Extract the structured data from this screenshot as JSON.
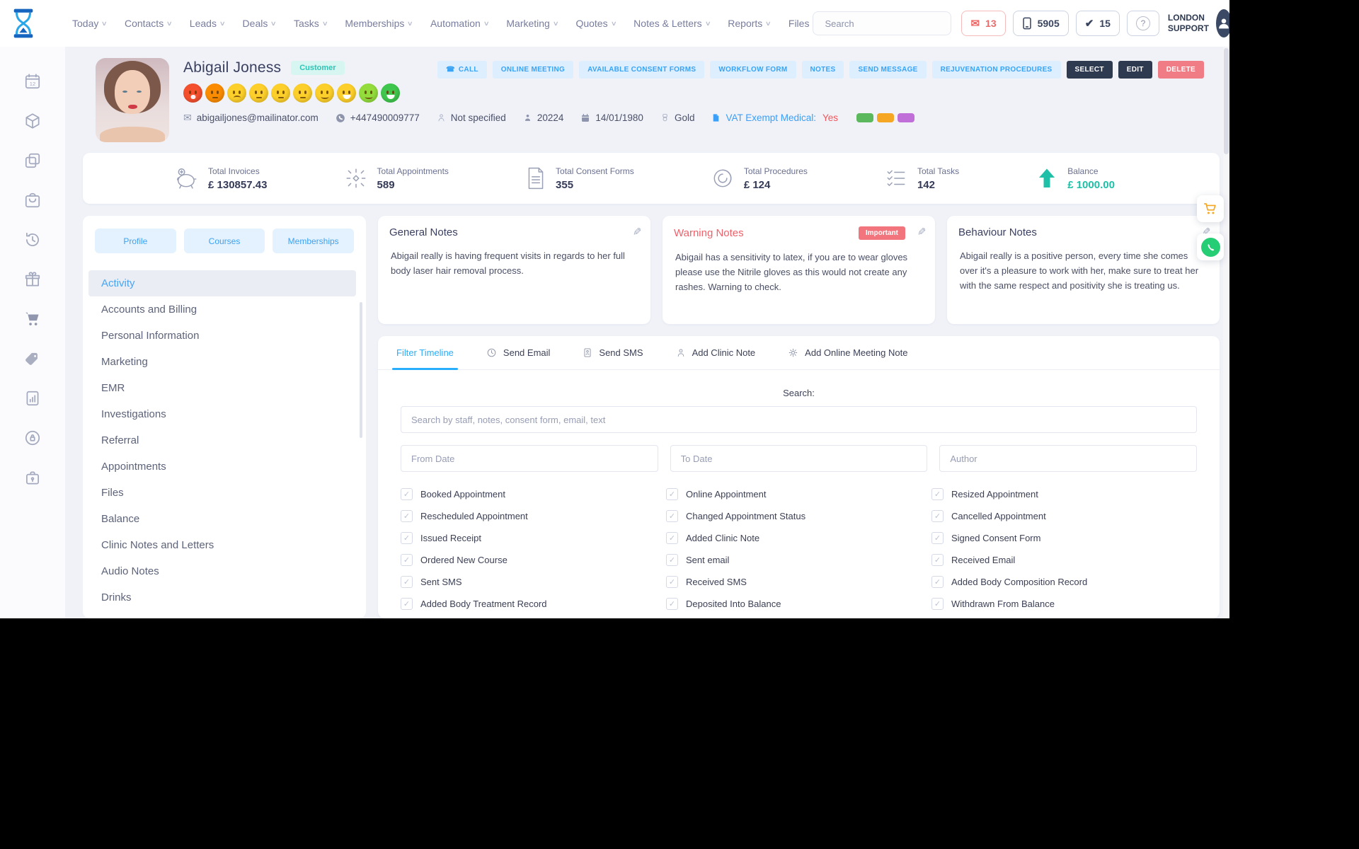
{
  "navbar": {
    "items": [
      {
        "label": "Today",
        "chevron": "∨"
      },
      {
        "label": "Contacts",
        "chevron": "∨"
      },
      {
        "label": "Leads",
        "chevron": "∨"
      },
      {
        "label": "Deals",
        "chevron": "∨"
      },
      {
        "label": "Tasks",
        "chevron": "∨"
      },
      {
        "label": "Memberships",
        "chevron": "∨"
      },
      {
        "label": "Automation",
        "chevron": "∨"
      },
      {
        "label": "Marketing",
        "chevron": "∨"
      },
      {
        "label": "Quotes",
        "chevron": "∨"
      },
      {
        "label": "Notes & Letters",
        "chevron": "∨"
      },
      {
        "label": "Reports",
        "chevron": "∨"
      },
      {
        "label": "Files",
        "chevron": ""
      }
    ],
    "search_placeholder": "Search",
    "badges": {
      "mail_count": "13",
      "phone_count": "5905",
      "task_count": "15",
      "help": "?"
    },
    "user_line1": "LONDON",
    "user_line2": "SUPPORT"
  },
  "icons": {
    "mail": "✉",
    "check": "✔",
    "check_small": "✓",
    "pencil": "✎",
    "phone_call": "☎"
  },
  "customer": {
    "name": "Abigail Joness",
    "badge": "Customer",
    "email": "abigailjones@mailinator.com",
    "phone": "+447490009777",
    "occupation": "Not specified",
    "id": "20224",
    "dob": "14/01/1980",
    "tier": "Gold",
    "vat_label": "VAT Exempt Medical:",
    "vat_value": "Yes",
    "tag_colors": [
      {
        "color": "#5cb85c"
      },
      {
        "color": "#f5a623"
      },
      {
        "color": "#c06fd8"
      }
    ],
    "smileys": [
      {
        "color": "#f4502e",
        "mouth": "m-open"
      },
      {
        "color": "#fb8c00",
        "mouth": "m-flat"
      },
      {
        "color": "#fccf2b",
        "mouth": "m-frown"
      },
      {
        "color": "#fccf2b",
        "mouth": "m-flat"
      },
      {
        "color": "#fccf2b",
        "mouth": "m-flat"
      },
      {
        "color": "#fccf2b",
        "mouth": "m-flat"
      },
      {
        "color": "#fccf2b",
        "mouth": "m-smile"
      },
      {
        "color": "#fccf2b",
        "mouth": "m-grin"
      },
      {
        "color": "#93dc3c",
        "mouth": "m-smile"
      },
      {
        "color": "#3fc64d",
        "mouth": "m-grin"
      }
    ]
  },
  "actions": [
    {
      "label": "CALL",
      "variant": "light",
      "icon": "☎"
    },
    {
      "label": "ONLINE MEETING",
      "variant": "light",
      "icon": ""
    },
    {
      "label": "AVAILABLE CONSENT FORMS",
      "variant": "light",
      "icon": ""
    },
    {
      "label": "WORKFLOW FORM",
      "variant": "light",
      "icon": ""
    },
    {
      "label": "NOTES",
      "variant": "light",
      "icon": ""
    },
    {
      "label": "SEND MESSAGE",
      "variant": "light",
      "icon": ""
    },
    {
      "label": "REJUVENATION PROCEDURES",
      "variant": "light",
      "icon": ""
    },
    {
      "label": "SELECT",
      "variant": "dark",
      "icon": ""
    },
    {
      "label": "EDIT",
      "variant": "dark",
      "icon": ""
    },
    {
      "label": "DELETE",
      "variant": "danger",
      "icon": ""
    }
  ],
  "stats": [
    {
      "label": "Total Invoices",
      "value": "£ 130857.43"
    },
    {
      "label": "Total Appointments",
      "value": "589"
    },
    {
      "label": "Total Consent Forms",
      "value": "355"
    },
    {
      "label": "Total Procedures",
      "value": "£ 124"
    },
    {
      "label": "Total Tasks",
      "value": "142"
    },
    {
      "label": "Balance",
      "value": "£ 1000.00"
    }
  ],
  "sidebar_icons": [
    "calendar-icon",
    "package-icon",
    "layers-icon",
    "booking-icon",
    "history-icon",
    "gift-icon",
    "cart-icon",
    "tag-icon",
    "report-icon",
    "security-icon",
    "case-icon"
  ],
  "left_panel": {
    "tabs": [
      {
        "label": "Profile"
      },
      {
        "label": "Courses"
      },
      {
        "label": "Memberships"
      }
    ],
    "menu": [
      {
        "label": "Activity",
        "state": "active"
      },
      {
        "label": "Accounts and Billing",
        "state": ""
      },
      {
        "label": "Personal Information",
        "state": ""
      },
      {
        "label": "Marketing",
        "state": ""
      },
      {
        "label": "EMR",
        "state": ""
      },
      {
        "label": "Investigations",
        "state": ""
      },
      {
        "label": "Referral",
        "state": ""
      },
      {
        "label": "Appointments",
        "state": ""
      },
      {
        "label": "Files",
        "state": ""
      },
      {
        "label": "Balance",
        "state": ""
      },
      {
        "label": "Clinic Notes and Letters",
        "state": ""
      },
      {
        "label": "Audio Notes",
        "state": ""
      },
      {
        "label": "Drinks",
        "state": ""
      }
    ]
  },
  "notes": {
    "general": {
      "title": "General Notes",
      "text": "Abigail really is having frequent visits in regards to her full body laser hair removal process."
    },
    "warning": {
      "title": "Warning Notes",
      "badge": "Important",
      "text": "Abigail has a sensitivity to latex, if you are to wear gloves please use the Nitrile gloves as this would not create any rashes. Warning to check."
    },
    "behaviour": {
      "title": "Behaviour Notes",
      "text": "Abigail really is a positive person, every time she comes over it's a pleasure to work with her, make sure to treat her with the same respect and positivity she is treating us."
    }
  },
  "timeline": {
    "tabs": [
      {
        "label": "Filter Timeline"
      },
      {
        "label": "Send Email"
      },
      {
        "label": "Send SMS"
      },
      {
        "label": "Add Clinic Note"
      },
      {
        "label": "Add Online Meeting Note"
      }
    ],
    "search_label": "Search:",
    "search_placeholder": "Search by staff, notes, consent form, email, text",
    "from_placeholder": "From Date",
    "to_placeholder": "To Date",
    "author_placeholder": "Author",
    "checkboxes": [
      {
        "label": "Booked Appointment"
      },
      {
        "label": "Online Appointment"
      },
      {
        "label": "Resized Appointment"
      },
      {
        "label": "Rescheduled Appointment"
      },
      {
        "label": "Changed Appointment Status"
      },
      {
        "label": "Cancelled Appointment"
      },
      {
        "label": "Issued Receipt"
      },
      {
        "label": "Added Clinic Note"
      },
      {
        "label": "Signed Consent Form"
      },
      {
        "label": "Ordered New Course"
      },
      {
        "label": "Sent email"
      },
      {
        "label": "Received Email"
      },
      {
        "label": "Sent SMS"
      },
      {
        "label": "Received SMS"
      },
      {
        "label": "Added Body Composition Record"
      },
      {
        "label": "Added Body Treatment Record"
      },
      {
        "label": "Deposited Into Balance"
      },
      {
        "label": "Withdrawn From Balance"
      }
    ]
  },
  "colors": {
    "accent_blue": "#37a3f6",
    "teal": "#1fc0a7",
    "danger": "#f07d86",
    "dark_navy": "#2e3a50",
    "cart_orange": "#f5a623",
    "whatsapp_green": "#25cd74"
  }
}
